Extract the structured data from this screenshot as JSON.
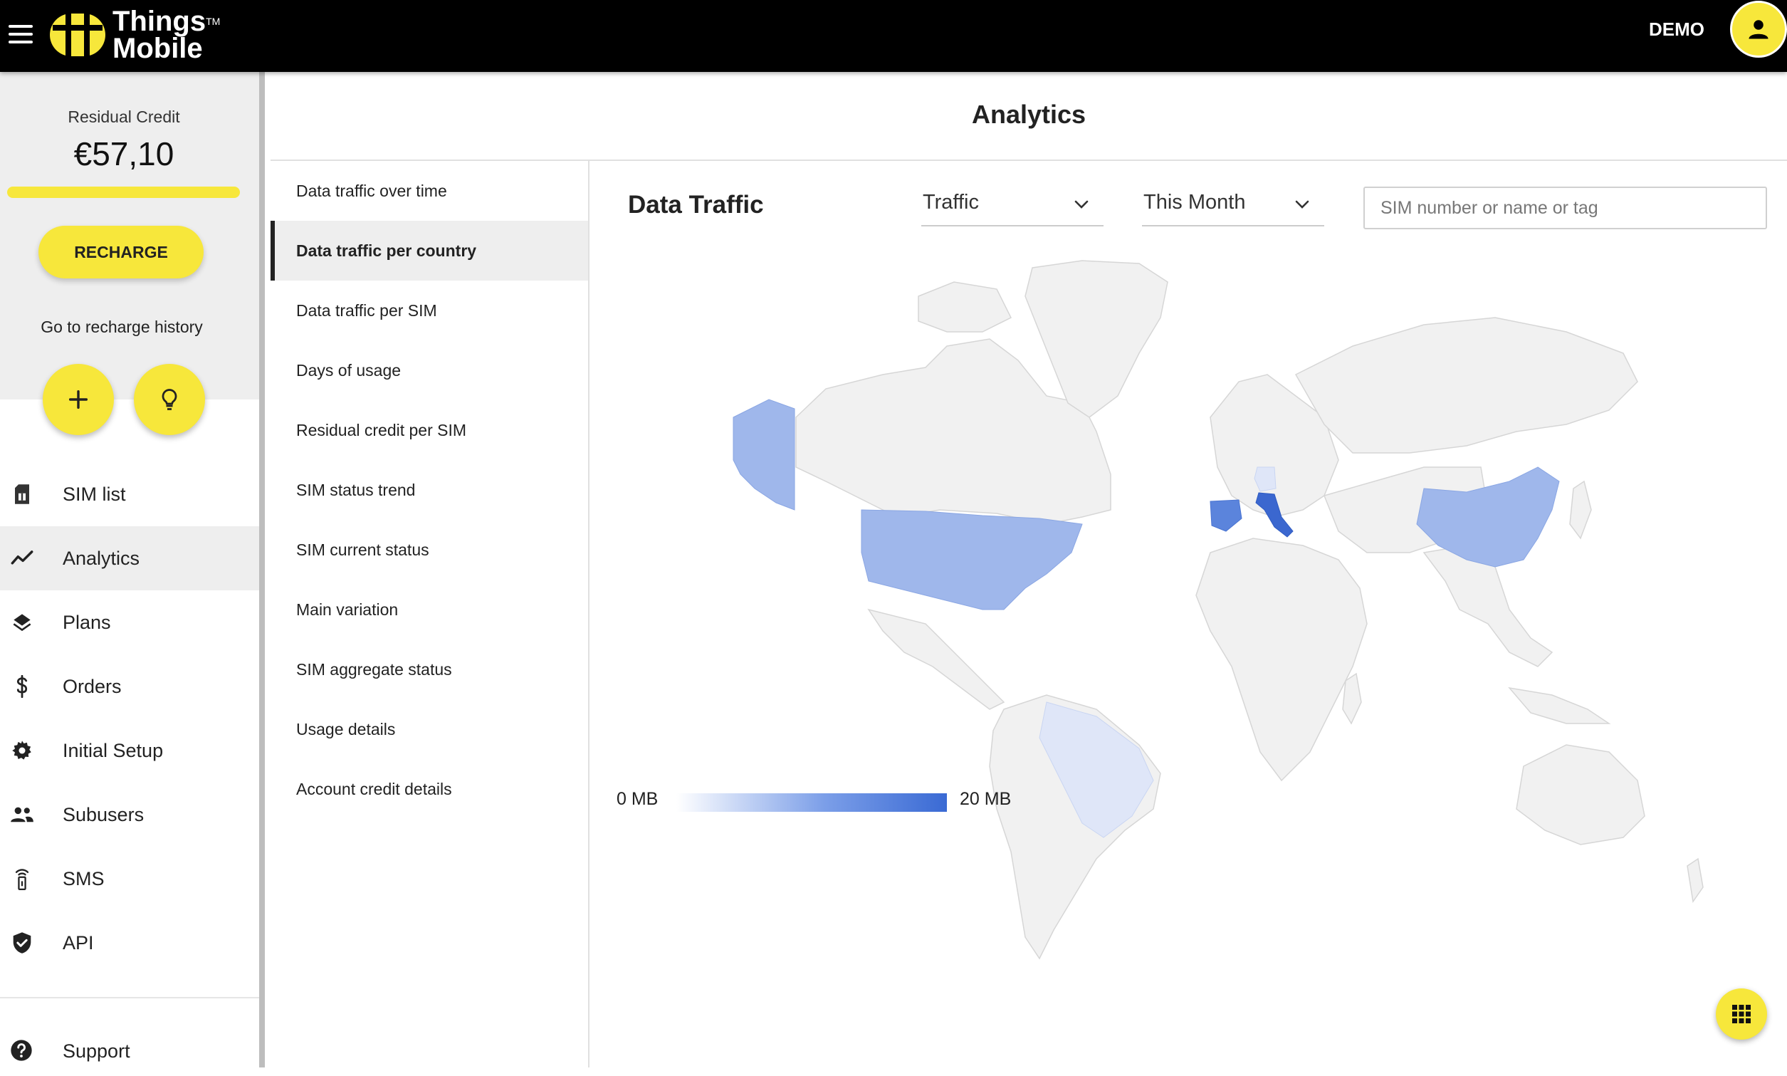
{
  "header": {
    "logo_line1": "Things",
    "logo_tm": "TM",
    "logo_line2": "Mobile",
    "account_label": "DEMO"
  },
  "sidebar": {
    "credit_label": "Residual Credit",
    "credit_value": "€57,10",
    "credit_level_fraction": 1.0,
    "recharge_label": "RECHARGE",
    "history_link": "Go to recharge history",
    "nav": [
      {
        "label": "SIM list",
        "icon": "sim-card-icon"
      },
      {
        "label": "Analytics",
        "icon": "trending-line-icon",
        "active": true
      },
      {
        "label": "Plans",
        "icon": "layers-icon"
      },
      {
        "label": "Orders",
        "icon": "dollar-icon"
      },
      {
        "label": "Initial Setup",
        "icon": "gear-icon"
      },
      {
        "label": "Subusers",
        "icon": "people-icon"
      },
      {
        "label": "SMS",
        "icon": "antenna-icon"
      },
      {
        "label": "API",
        "icon": "shield-check-icon"
      }
    ],
    "support_label": "Support"
  },
  "main": {
    "page_title": "Analytics",
    "menu": [
      {
        "label": "Data traffic over time"
      },
      {
        "label": "Data traffic per country",
        "active": true
      },
      {
        "label": "Data traffic per SIM"
      },
      {
        "label": "Days of usage"
      },
      {
        "label": "Residual credit per SIM"
      },
      {
        "label": "SIM status trend"
      },
      {
        "label": "SIM current status"
      },
      {
        "label": "Main variation"
      },
      {
        "label": "SIM aggregate status"
      },
      {
        "label": "Usage details"
      },
      {
        "label": "Account credit details"
      }
    ],
    "panel_title": "Data Traffic",
    "metric_select": "Traffic",
    "period_select": "This Month",
    "search_placeholder": "SIM number or name or tag",
    "legend_min": "0 MB",
    "legend_max": "20 MB"
  },
  "colors": {
    "accent_yellow": "#f7e73b",
    "header_black": "#000000",
    "map_land": "#f1f1f1",
    "map_light": "#dfe6f8",
    "map_medium": "#9fb7eb",
    "map_strong": "#3b67cf"
  }
}
